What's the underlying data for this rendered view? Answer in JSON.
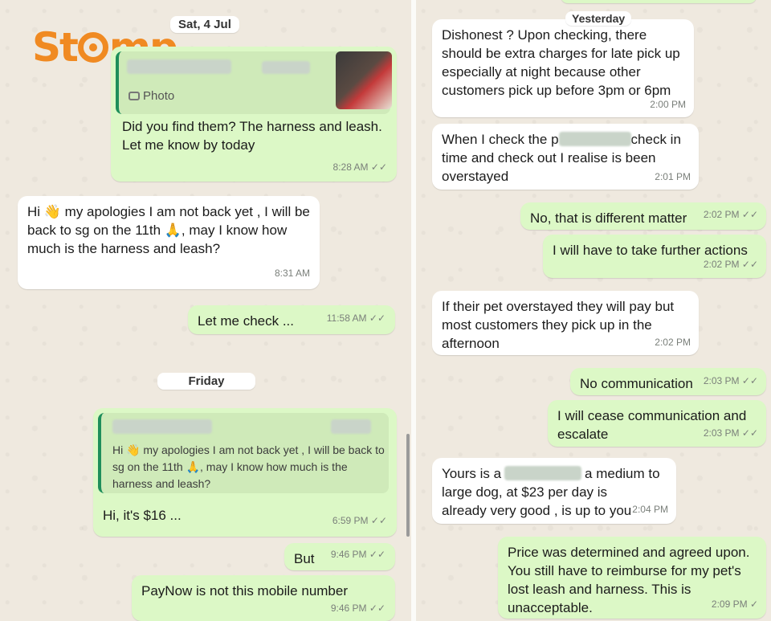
{
  "watermark": {
    "logo_text_pre": "St",
    "logo_text_post": "mp"
  },
  "left": {
    "date_chip": "Sat, 4 Jul",
    "photo_reply": {
      "label": "Photo",
      "message": "Did you find them? The harness and leash. Let me know by today",
      "time": "8:28 AM"
    },
    "msg1": {
      "text": "Hi 👋 my apologies I am not back yet , I will be back to sg on the 11th 🙏, may I know how much is the harness and leash?",
      "time": "8:31 AM"
    },
    "msg2": {
      "text": "Let me check ...",
      "time": "11:58 AM"
    },
    "friday_chip": "Friday",
    "reply": {
      "quoted": "Hi 👋 my apologies I am not back yet , I will be back to sg on the 11th 🙏, may I know how much is the harness and leash?",
      "message": "Hi, it's $16 ...",
      "time": "6:59 PM"
    },
    "msg3": {
      "text": "But",
      "time": "9:46 PM"
    },
    "msg4": {
      "text": "PayNow is not this mobile number",
      "time": "9:46 PM"
    }
  },
  "right": {
    "yesterday_chip": "Yesterday",
    "r1": {
      "text": "Dishonest ? Upon checking, there should be extra charges for late pick up especially at night because other customers pick up before 3pm or 6pm",
      "time": "2:00 PM"
    },
    "r2": {
      "text_a": "When I check the p",
      "text_b": "check in",
      "text_c": "time and check out I realise is been overstayed",
      "time": "2:01 PM"
    },
    "r3": {
      "text": "No, that is different matter",
      "time": "2:02 PM"
    },
    "r4": {
      "text": "I will have to take further actions",
      "time": "2:02 PM"
    },
    "r5": {
      "text": "If their pet overstayed they will pay but most customers they pick up in the afternoon",
      "time": "2:02 PM"
    },
    "r6": {
      "text": "No communication",
      "time": "2:03 PM"
    },
    "r7": {
      "text": "I will cease communication and escalate",
      "time": "2:03 PM"
    },
    "r8": {
      "text_a": "Yours is a",
      "text_b": "a medium to",
      "text_c": "large dog, at $23 per day is already very good , is up to you",
      "time": "2:04 PM"
    },
    "r9": {
      "text": "Price was determined and agreed upon. You still have to reimburse for my pet's lost leash and harness. This is unacceptable.",
      "time": "2:09 PM"
    }
  },
  "ticks": "✓✓",
  "single_tick": "✓"
}
